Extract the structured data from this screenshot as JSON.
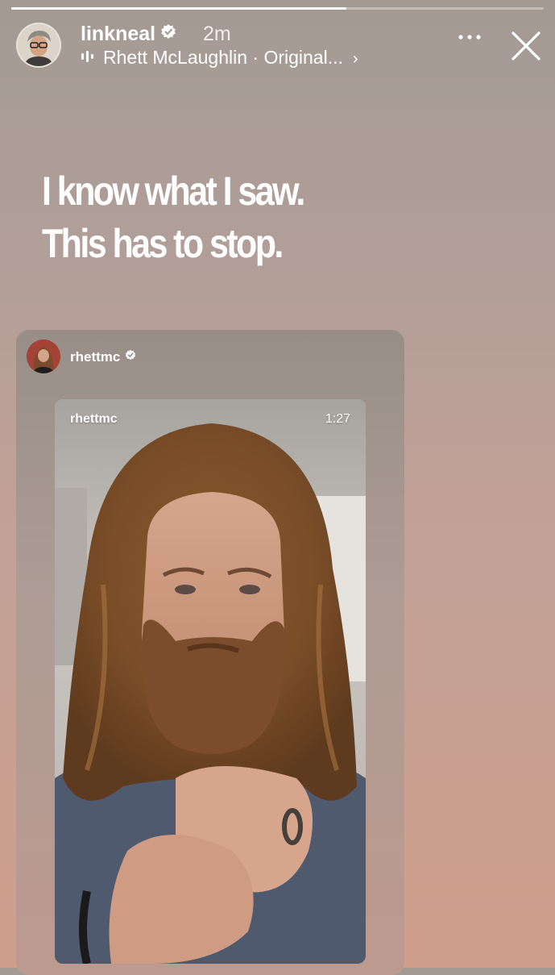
{
  "story": {
    "progress": 0.63,
    "author": {
      "username": "linkneal",
      "time_ago": "2m"
    },
    "audio": {
      "artist": "Rhett McLaughlin",
      "track": "· Original..."
    },
    "caption_lines": [
      "I know what I saw.",
      "This has to stop."
    ]
  },
  "shared_post": {
    "username": "rhettmc",
    "video": {
      "username": "rhettmc",
      "duration": "1:27"
    }
  },
  "colors": {
    "verified_blue": "#ffffff",
    "text": "#ffffff"
  }
}
